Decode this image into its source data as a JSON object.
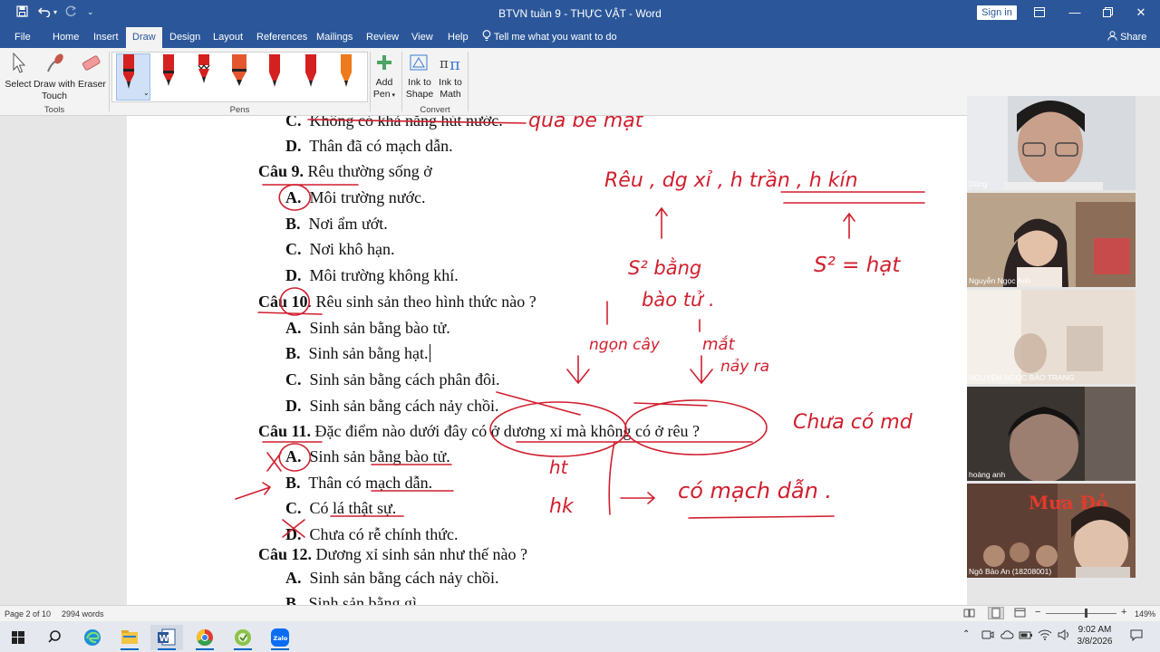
{
  "window": {
    "title": "BTVN tuần 9 - THỰC VẬT  -  Word",
    "signin_label": "Sign in",
    "undo_icon": "undo-icon",
    "colors": {
      "brand": "#2b579a",
      "ink": "#d01f2e"
    }
  },
  "ribbon": {
    "tabs": [
      "File",
      "Home",
      "Insert",
      "Draw",
      "Design",
      "Layout",
      "References",
      "Mailings",
      "Review",
      "View",
      "Help"
    ],
    "active_tab": "Draw",
    "tell_me": "Tell me what you want to do",
    "share": "Share",
    "tools": {
      "select": "Select",
      "draw_with": "Draw with",
      "touch": "Touch",
      "eraser": "Eraser",
      "group": "Tools"
    },
    "pens_group": "Pens",
    "add_pen": {
      "line1": "Add",
      "line2": "Pen"
    },
    "convert": {
      "ink_shape_1": "Ink to",
      "ink_shape_2": "Shape",
      "ink_math_1": "Ink to",
      "ink_math_2": "Math",
      "group": "Convert"
    }
  },
  "document": {
    "lines": [
      {
        "label": "C.",
        "text": "Không có khả năng hút nước."
      },
      {
        "label": "D.",
        "text": "Thân đã có mạch dẫn."
      },
      {
        "q": "Câu 9.",
        "text": " Rêu thường sống ở"
      },
      {
        "label": "A.",
        "text": "Môi trường nước."
      },
      {
        "label": "B.",
        "text": "Nơi ẩm ướt."
      },
      {
        "label": "C.",
        "text": "Nơi khô hạn."
      },
      {
        "label": "D.",
        "text": "Môi trường không khí."
      },
      {
        "q": "Câu 10",
        "text": ". Rêu sinh sản theo hình thức nào ?"
      },
      {
        "label": "A.",
        "text": "Sinh sản bằng bào tử."
      },
      {
        "label": "B.",
        "text": "Sinh sản bằng hạt."
      },
      {
        "label": "C.",
        "text": "Sinh sản bằng cách phân đôi."
      },
      {
        "label": "D.",
        "text": "Sinh sản bằng cách nảy chồi."
      },
      {
        "q": "Câu 11.",
        "text": " Đặc điểm nào dưới đây có ở dương xỉ mà không có ở rêu ?"
      },
      {
        "label": "A.",
        "text": "Sinh sản bằng bào tử."
      },
      {
        "label": "B.",
        "text": "Thân có mạch dẫn."
      },
      {
        "label": "C.",
        "text": "Có lá thật sự."
      },
      {
        "label": "D.",
        "text": "Chưa có rễ chính thức."
      },
      {
        "q": "Câu 12.",
        "text": " Dương xỉ sinh sản như thế nào ?"
      },
      {
        "label": "A.",
        "text": "Sinh sản bằng cách nảy chồi."
      },
      {
        "label": "B.",
        "text": "Sinh sản bằng gì"
      }
    ],
    "ink_notes": {
      "top": "qua bề mặt",
      "list": "Rêu , dg xỉ , h trần , h kín",
      "s2_spore": "S² bằng",
      "spore": "bào tử .",
      "s2_seed": "S² = hạt",
      "root_tip": "ngọn cây",
      "eye": "mắt",
      "sprout": "nảy ra",
      "no_vessel": "Chưa có md",
      "ht": "ht",
      "hk": "hk",
      "has_vessel": "có mạch dẫn ."
    }
  },
  "participants": [
    {
      "name": "Dũng"
    },
    {
      "name": "Nguyễn Ngọc Anh"
    },
    {
      "name": "NGUYỄN NGỌC BẢO TRANG"
    },
    {
      "name": "hoàng anh"
    },
    {
      "name": "Ngô Bảo An (18208001)",
      "poster_text": "Mưa Đỏ"
    }
  ],
  "status": {
    "page": "Page 2 of 10",
    "words": "2994 words",
    "zoom": "149%"
  },
  "taskbar": {
    "time": "9:02 AM",
    "date": "3/8/2026",
    "zalo": "Zalo"
  }
}
